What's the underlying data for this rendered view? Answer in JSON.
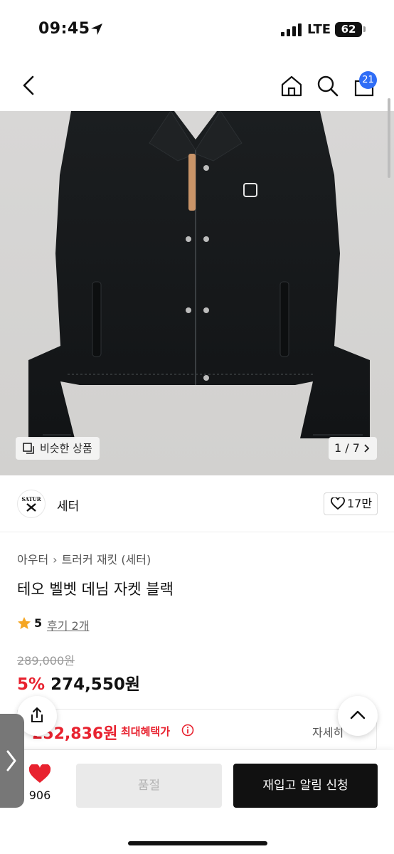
{
  "status_bar": {
    "time": "09:45",
    "network": "LTE",
    "battery": "62"
  },
  "nav": {
    "cart_count": "21"
  },
  "image": {
    "similar_label": "비슷한 상품",
    "counter": "1 / 7"
  },
  "brand": {
    "logo_text": "SATUR",
    "name": "세터",
    "likes": "17만"
  },
  "breadcrumb": {
    "category": "아우터",
    "subcategory": "트러커 재킷 (세터)"
  },
  "product": {
    "title": "테오 벨벳 데님 자켓 블랙",
    "rating": "5",
    "reviews": "후기 2개",
    "original_price": "289,000원",
    "discount": "5%",
    "sale_price": "274,550원"
  },
  "benefit": {
    "price": "252,836원",
    "label": "최대혜택가",
    "detail": "자세히"
  },
  "bottom": {
    "wish_count": "906",
    "soldout_label": "품절",
    "restock_label": "재입고 알림 신청"
  },
  "colors": {
    "accent_red": "#e8222f",
    "badge_blue": "#2f6df6",
    "primary_black": "#111111"
  },
  "icons": [
    "back-icon",
    "home-icon",
    "search-icon",
    "cart-icon",
    "similar-icon",
    "chevron-right-icon",
    "heart-outline-icon",
    "star-icon",
    "info-icon",
    "share-icon",
    "chevron-up-icon",
    "heart-filled-icon"
  ]
}
